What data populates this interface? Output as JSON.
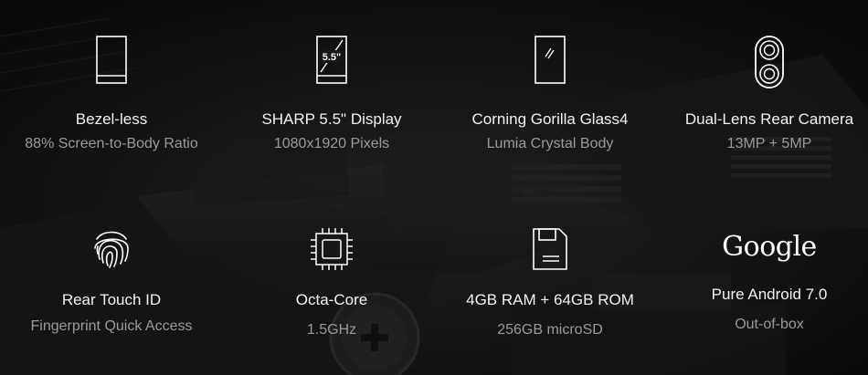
{
  "colors": {
    "background": "#121212",
    "title": "#f2f2f2",
    "subtitle": "#9a9a9a",
    "icon_stroke": "#ffffff"
  },
  "features": [
    {
      "icon": "phone-outline-icon",
      "title": "Bezel-less",
      "subtitle": "88% Screen-to-Body Ratio"
    },
    {
      "icon": "display-size-icon",
      "icon_label": "5.5\"",
      "title": "SHARP 5.5\" Display",
      "subtitle": "1080x1920 Pixels"
    },
    {
      "icon": "glass-panel-icon",
      "title": "Corning Gorilla Glass4",
      "subtitle": "Lumia Crystal Body"
    },
    {
      "icon": "dual-lens-camera-icon",
      "title": "Dual-Lens Rear Camera",
      "subtitle": "13MP + 5MP"
    },
    {
      "icon": "fingerprint-icon",
      "title": "Rear Touch ID",
      "subtitle": "Fingerprint Quick Access"
    },
    {
      "icon": "cpu-chip-icon",
      "title": "Octa-Core",
      "subtitle": "1.5GHz"
    },
    {
      "icon": "sd-card-icon",
      "title": "4GB RAM + 64GB ROM",
      "subtitle": "256GB microSD"
    },
    {
      "icon": "google-logo",
      "logo_text": "Google",
      "title": "Pure Android 7.0",
      "subtitle": "Out-of-box"
    }
  ]
}
